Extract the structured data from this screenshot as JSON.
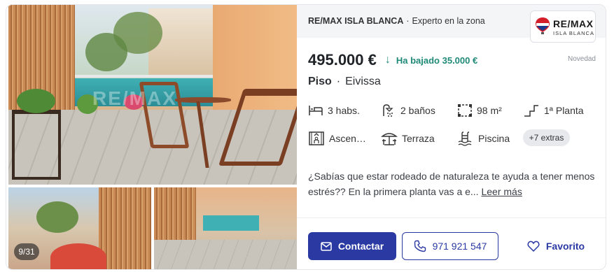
{
  "gallery": {
    "counter": "9/31",
    "watermark": "RE/MAX"
  },
  "agency": {
    "name": "RE/MAX ISLA BLANCA",
    "tagline": "Experto en la zona",
    "logo_line1": "RE/MAX",
    "logo_line2": "ISLA BLANCA"
  },
  "listing": {
    "price": "495.000 €",
    "price_drop": "Ha bajado 35.000 €",
    "badge": "Novedad",
    "type": "Piso",
    "location": "Eivissa"
  },
  "features": [
    {
      "icon": "bed-icon",
      "label": "3 habs."
    },
    {
      "icon": "shower-icon",
      "label": "2 baños"
    },
    {
      "icon": "area-icon",
      "label": "98 m²"
    },
    {
      "icon": "floor-icon",
      "label": "1ª Planta"
    },
    {
      "icon": "elevator-icon",
      "label": "Ascen…"
    },
    {
      "icon": "terrace-icon",
      "label": "Terraza"
    },
    {
      "icon": "pool-icon",
      "label": "Piscina"
    }
  ],
  "extras": "+7 extras",
  "description": {
    "text": "¿Sabías que estar rodeado de naturaleza te ayuda a tener menos estrés?? En la primera planta vas a e...",
    "more": "Leer más"
  },
  "actions": {
    "contact": "Contactar",
    "phone": "971 921 547",
    "favorite": "Favorito"
  },
  "colors": {
    "primary": "#2b39a3",
    "price_drop": "#1f8a78"
  }
}
